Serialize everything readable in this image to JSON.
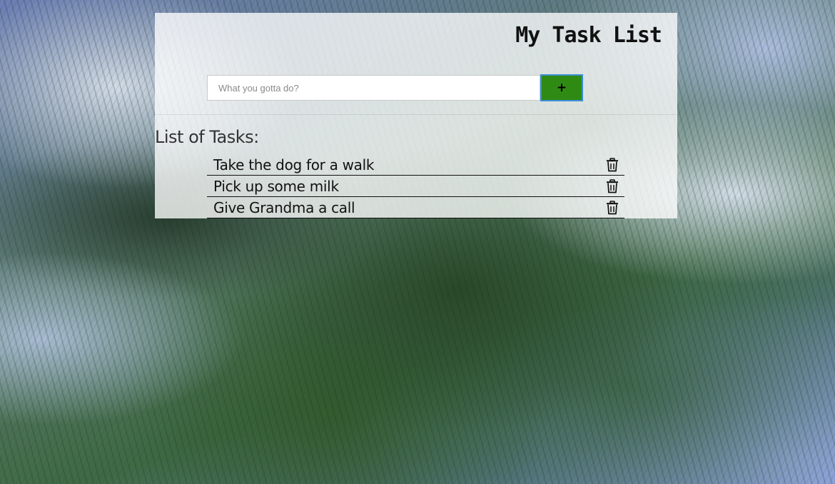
{
  "app": {
    "title": "My Task List"
  },
  "form": {
    "input_value": "",
    "input_placeholder": "What you gotta do?",
    "add_button_label": "+"
  },
  "list": {
    "heading": "List of Tasks:",
    "tasks": [
      {
        "text": "Take the dog for a walk",
        "action_icon": "trash-icon"
      },
      {
        "text": "Pick up some milk",
        "action_icon": "trash-icon"
      },
      {
        "text": "Give Grandma a call",
        "action_icon": "trash-icon"
      }
    ]
  },
  "colors": {
    "add_button_bg": "#2f8a14",
    "add_button_border": "#3a8fd6",
    "panel_bg": "rgba(255,255,255,0.78)",
    "text": "#111111"
  }
}
